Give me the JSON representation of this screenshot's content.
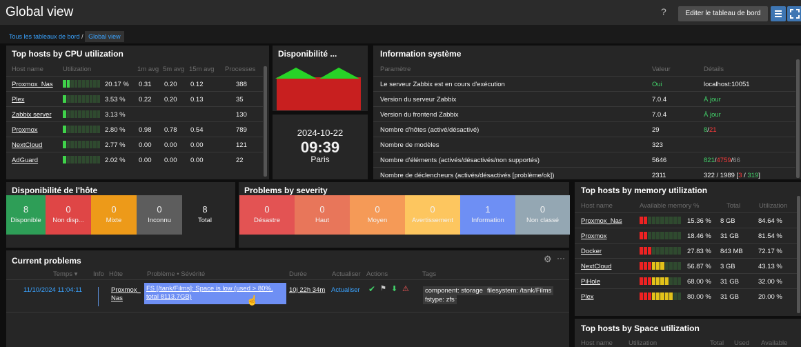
{
  "header": {
    "title": "Global view",
    "help": "?",
    "edit_label": "Editer le tableau de bord"
  },
  "breadcrumb": {
    "all": "Tous les tableaux de bord",
    "sep": "/",
    "current": "Global view"
  },
  "cpu": {
    "title": "Top hosts by CPU utilization",
    "columns": [
      "Host name",
      "Utilization",
      "1m avg",
      "5m avg",
      "15m avg",
      "Processes"
    ],
    "rows": [
      {
        "host": "Proxmox_Nas",
        "util": "20.17 %",
        "m1": "0.31",
        "m5": "0.20",
        "m15": "0.12",
        "proc": "388",
        "fill": 0.2
      },
      {
        "host": "Plex",
        "util": "3.53 %",
        "m1": "0.22",
        "m5": "0.20",
        "m15": "0.13",
        "proc": "35",
        "fill": 0.04
      },
      {
        "host": "Zabbix server",
        "util": "3.13 %",
        "m1": "",
        "m5": "",
        "m15": "",
        "proc": "130",
        "fill": 0.03
      },
      {
        "host": "Proxmox",
        "util": "2.80 %",
        "m1": "0.98",
        "m5": "0.78",
        "m15": "0.54",
        "proc": "789",
        "fill": 0.03
      },
      {
        "host": "NextCloud",
        "util": "2.77 %",
        "m1": "0.00",
        "m5": "0.00",
        "m15": "0.00",
        "proc": "121",
        "fill": 0.03
      },
      {
        "host": "AdGuard",
        "util": "2.02 %",
        "m1": "0.00",
        "m5": "0.00",
        "m15": "0.00",
        "proc": "22",
        "fill": 0.02
      }
    ]
  },
  "dispo": {
    "title": "Disponibilité ..."
  },
  "clock": {
    "date": "2024-10-22",
    "time": "09:39",
    "tz": "Paris"
  },
  "sysinfo": {
    "title": "Information système",
    "columns": [
      "Paramètre",
      "Valeur",
      "Détails"
    ],
    "rows": [
      {
        "param": "Le serveur Zabbix est en cours d'exécution",
        "value": "Oui",
        "d": [
          "localhost:10051"
        ]
      },
      {
        "param": "Version du serveur Zabbix",
        "value": "7.0.4",
        "d": [
          "À jour"
        ]
      },
      {
        "param": "Version du frontend Zabbix",
        "value": "7.0.4",
        "d": [
          "À jour"
        ]
      },
      {
        "param": "Nombre d'hôtes (activé/désactivé)",
        "value": "29",
        "d": [
          "8",
          "/",
          "21"
        ]
      },
      {
        "param": "Nombre de modèles",
        "value": "323",
        "d": []
      },
      {
        "param": "Nombre d'éléments (activés/désactivés/non supportés)",
        "value": "5646",
        "d": [
          "821",
          "/",
          "4759",
          "/",
          "66"
        ]
      },
      {
        "param": "Nombre de déclencheurs (activés/désactivés [problème/ok])",
        "value": "2311",
        "d": [
          "322 / 1989 [",
          "3",
          " / ",
          "319",
          "]"
        ]
      }
    ]
  },
  "avail": {
    "title": "Disponibilité de l'hôte",
    "tiles": [
      {
        "n": "8",
        "l": "Disponible",
        "c": "#2e9e57"
      },
      {
        "n": "0",
        "l": "Non disp...",
        "c": "#df4646"
      },
      {
        "n": "0",
        "l": "Mixte",
        "c": "#ed9a19"
      },
      {
        "n": "0",
        "l": "Inconnu",
        "c": "#5d5d5d"
      },
      {
        "n": "8",
        "l": "Total",
        "c": "#262626"
      }
    ]
  },
  "sev": {
    "title": "Problems by severity",
    "tiles": [
      {
        "n": "0",
        "l": "Désastre",
        "c": "#e35353"
      },
      {
        "n": "0",
        "l": "Haut",
        "c": "#e8765a"
      },
      {
        "n": "0",
        "l": "Moyen",
        "c": "#f59a57"
      },
      {
        "n": "0",
        "l": "Avertissement",
        "c": "#fdc65f"
      },
      {
        "n": "1",
        "l": "Information",
        "c": "#6e8ff4"
      },
      {
        "n": "0",
        "l": "Non classé",
        "c": "#94a7b3"
      }
    ]
  },
  "mem": {
    "title": "Top hosts by memory utilization",
    "columns": [
      "Host name",
      "Available memory %",
      "Total",
      "Utilization"
    ],
    "rows": [
      {
        "host": "Proxmox_Nas",
        "pct": "15.36 %",
        "total": "8 GB",
        "util": "84.64 %",
        "fill": 0.15
      },
      {
        "host": "Proxmox",
        "pct": "18.46 %",
        "total": "31 GB",
        "util": "81.54 %",
        "fill": 0.18
      },
      {
        "host": "Docker",
        "pct": "27.83 %",
        "total": "843 MB",
        "util": "72.17 %",
        "fill": 0.28
      },
      {
        "host": "NextCloud",
        "pct": "56.87 %",
        "total": "3 GB",
        "util": "43.13 %",
        "fill": 0.57
      },
      {
        "host": "PiHole",
        "pct": "68.00 %",
        "total": "31 GB",
        "util": "32.00 %",
        "fill": 0.68
      },
      {
        "host": "Plex",
        "pct": "80.00 %",
        "total": "31 GB",
        "util": "20.00 %",
        "fill": 0.8
      }
    ]
  },
  "space": {
    "title": "Top hosts by Space utilization",
    "columns": [
      "Host name",
      "Utilization",
      "Total",
      "Used",
      "Available"
    ]
  },
  "problems": {
    "title": "Current problems",
    "columns": [
      "Temps ▾",
      "Info",
      "Hôte",
      "Problème • Sévérité",
      "Durée",
      "Actualiser",
      "Actions",
      "Tags"
    ],
    "row": {
      "time": "11/10/2024 11:04:11",
      "host1": "Proxmox_",
      "host2": "Nas",
      "problem": "FS [/tank/Films]: Space is low (used > 80%, total 8113.7GB)",
      "duration": "10j 22h 34m",
      "update": "Actualiser",
      "tags": [
        "component: storage",
        "filesystem: /tank/Films",
        "fstype: zfs",
        "···"
      ]
    }
  }
}
